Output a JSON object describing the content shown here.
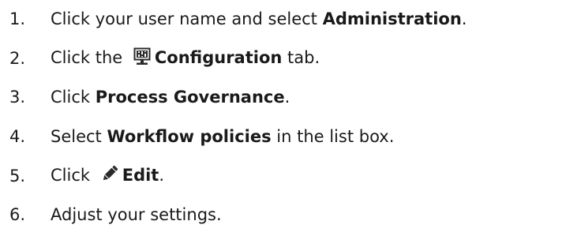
{
  "steps": [
    {
      "number": "1.",
      "before": "Click your user name and select ",
      "bold": "Administration",
      "after": "."
    },
    {
      "number": "2.",
      "before": "Click the ",
      "icon": "configuration-icon",
      "bold": "Configuration",
      "after": " tab."
    },
    {
      "number": "3.",
      "before": "Click ",
      "bold": "Process Governance",
      "after": "."
    },
    {
      "number": "4.",
      "before": "Select ",
      "bold": "Workflow policies",
      "after": " in the list box."
    },
    {
      "number": "5.",
      "before": "Click ",
      "icon": "pencil-icon",
      "bold": "Edit",
      "after": "."
    },
    {
      "number": "6.",
      "before": "Adjust your settings.",
      "bold": "",
      "after": ""
    }
  ]
}
